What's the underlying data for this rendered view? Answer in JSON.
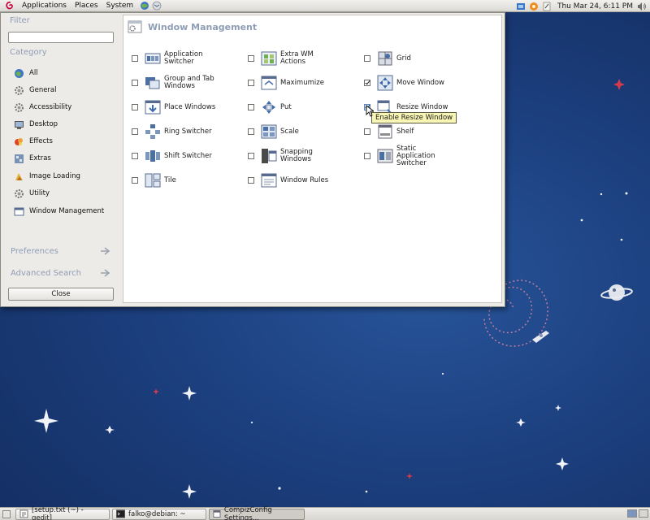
{
  "top_panel": {
    "menus": [
      "Applications",
      "Places",
      "System"
    ],
    "clock": "Thu Mar 24,  6:11 PM"
  },
  "window": {
    "filter_label": "Filter",
    "filter_value": "",
    "category_label": "Category",
    "categories": [
      "All",
      "General",
      "Accessibility",
      "Desktop",
      "Effects",
      "Extras",
      "Image Loading",
      "Utility",
      "Window Management"
    ],
    "preferences_label": "Preferences",
    "advanced_search_label": "Advanced Search",
    "close_label": "Close",
    "content_title": "Window Management",
    "plugins": [
      {
        "label": "Application Switcher",
        "checked": false
      },
      {
        "label": "Extra WM Actions",
        "checked": false
      },
      {
        "label": "Grid",
        "checked": false
      },
      {
        "label": "Group and Tab Windows",
        "checked": false
      },
      {
        "label": "Maximumize",
        "checked": false
      },
      {
        "label": "Move Window",
        "checked": true
      },
      {
        "label": "Place Windows",
        "checked": false
      },
      {
        "label": "Put",
        "checked": false
      },
      {
        "label": "Resize Window",
        "checked": true
      },
      {
        "label": "Ring Switcher",
        "checked": false
      },
      {
        "label": "Scale",
        "checked": false
      },
      {
        "label": "Shelf",
        "checked": false
      },
      {
        "label": "Shift Switcher",
        "checked": false
      },
      {
        "label": "Snapping Windows",
        "checked": false
      },
      {
        "label": "Static Application Switcher",
        "checked": false
      },
      {
        "label": "Tile",
        "checked": false
      },
      {
        "label": "Window Rules",
        "checked": false
      }
    ],
    "tooltip": "Enable Resize Window"
  },
  "taskbar": {
    "tasks": [
      "[setup.txt (~) - gedit]",
      "falko@debian: ~",
      "CompizConfig Settings..."
    ]
  },
  "colors": {
    "desktop_blue": "#1c3f7e",
    "heading_blue": "#8e9db6",
    "panel_grey": "#edebe8"
  }
}
